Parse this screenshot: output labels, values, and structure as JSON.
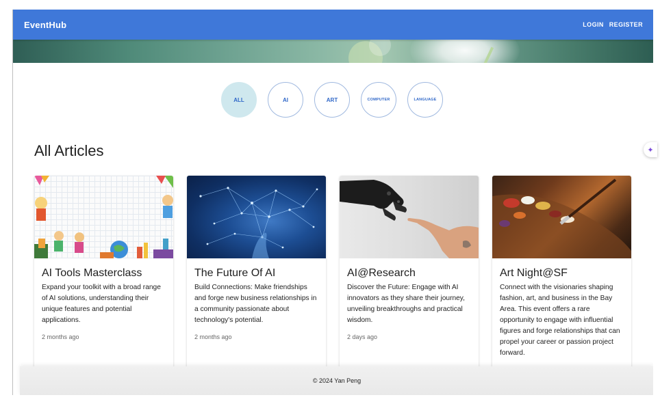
{
  "appbar": {
    "brand": "EventHub",
    "nav": [
      "LOGIN",
      "REGISTER"
    ]
  },
  "categories": [
    {
      "label": "ALL",
      "active": true
    },
    {
      "label": "AI",
      "active": false
    },
    {
      "label": "ART",
      "active": false
    },
    {
      "label": "COMPUTER",
      "active": false
    },
    {
      "label": "LANGUAGE",
      "active": false
    }
  ],
  "section_title": "All Articles",
  "articles": [
    {
      "title": "AI Tools Masterclass",
      "description": "Expand your toolkit with a broad range of AI solutions, understanding their unique features and potential applications.",
      "time": "2 months ago",
      "image_icon": "kids-doodle-illustration"
    },
    {
      "title": "The Future Of AI",
      "description": "Build Connections: Make friendships and forge new business relationships in a community passionate about technology's potential.",
      "time": "2 months ago",
      "image_icon": "network-hand-illustration"
    },
    {
      "title": "AI@Research",
      "description": "Discover the Future: Engage with AI innovators as they share their journey, unveiling breakthroughs and practical wisdom.",
      "time": "2 days ago",
      "image_icon": "robot-human-hand-photo"
    },
    {
      "title": "Art Night@SF",
      "description": "Connect with the visionaries shaping fashion, art, and business in the Bay Area. This event offers a rare opportunity to engage with influential figures and forge relationships that can propel your career or passion project forward.",
      "time": "",
      "image_icon": "paint-palette-photo"
    }
  ],
  "footer": "© 2024 Yan Peng",
  "colors": {
    "appbar": "#3f78d9",
    "chip_text": "#2f67c8",
    "chip_active_bg": "#cfe8ee"
  }
}
